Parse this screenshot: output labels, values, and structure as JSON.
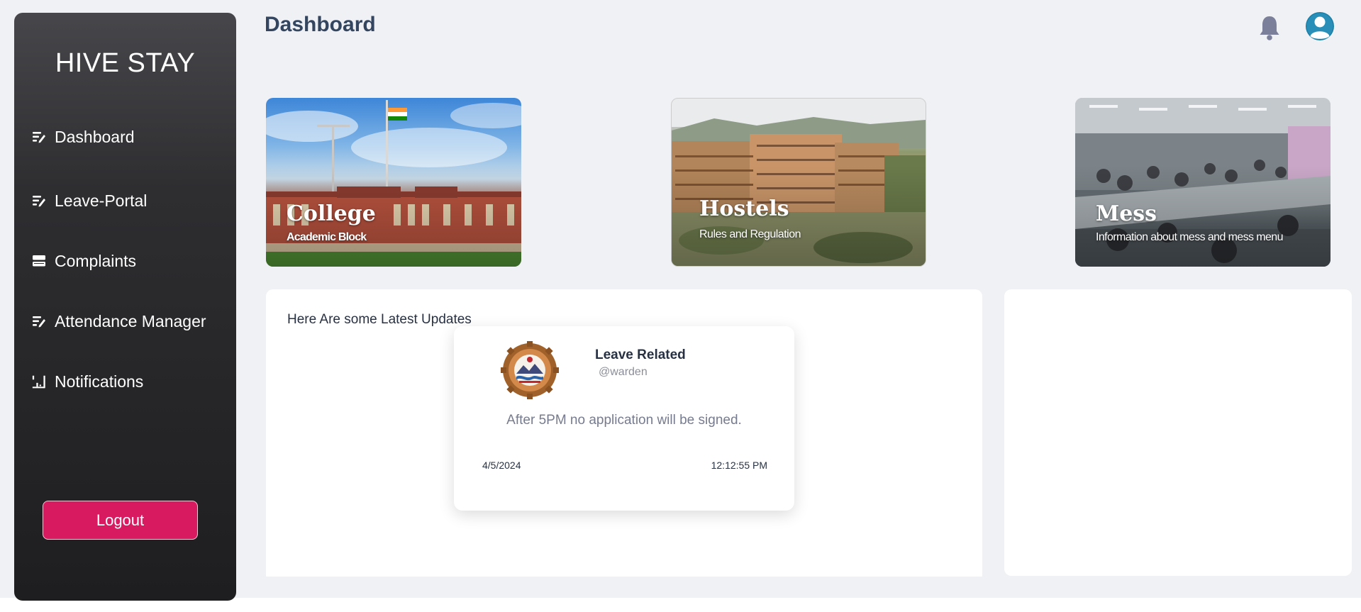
{
  "app": {
    "brand": "HIVE STAY"
  },
  "sidebar": {
    "items": [
      {
        "label": "Dashboard",
        "icon": "dashboard-icon"
      },
      {
        "label": "Leave-Portal",
        "icon": "leave-icon"
      },
      {
        "label": "Complaints",
        "icon": "complaints-icon"
      },
      {
        "label": "Attendance Manager",
        "icon": "attendance-icon"
      },
      {
        "label": "Notifications",
        "icon": "notifications-icon"
      }
    ],
    "logout_label": "Logout"
  },
  "header": {
    "title": "Dashboard"
  },
  "cards": [
    {
      "title": "College",
      "subtitle": "Academic Block"
    },
    {
      "title": "Hostels",
      "subtitle": "Rules and Regulation"
    },
    {
      "title": "Mess",
      "subtitle": "Information about mess and mess menu"
    }
  ],
  "updates": {
    "heading": "Here Are some Latest Updates",
    "items": [
      {
        "title": "Leave Related",
        "author": "@warden",
        "message": "After 5PM no application will be signed.",
        "date": "4/5/2024",
        "time": "12:12:55 PM"
      }
    ]
  },
  "colors": {
    "accent": "#d81b60",
    "title": "#34465f",
    "sidebar_top": "#47474b",
    "sidebar_bottom": "#1e1e20"
  }
}
